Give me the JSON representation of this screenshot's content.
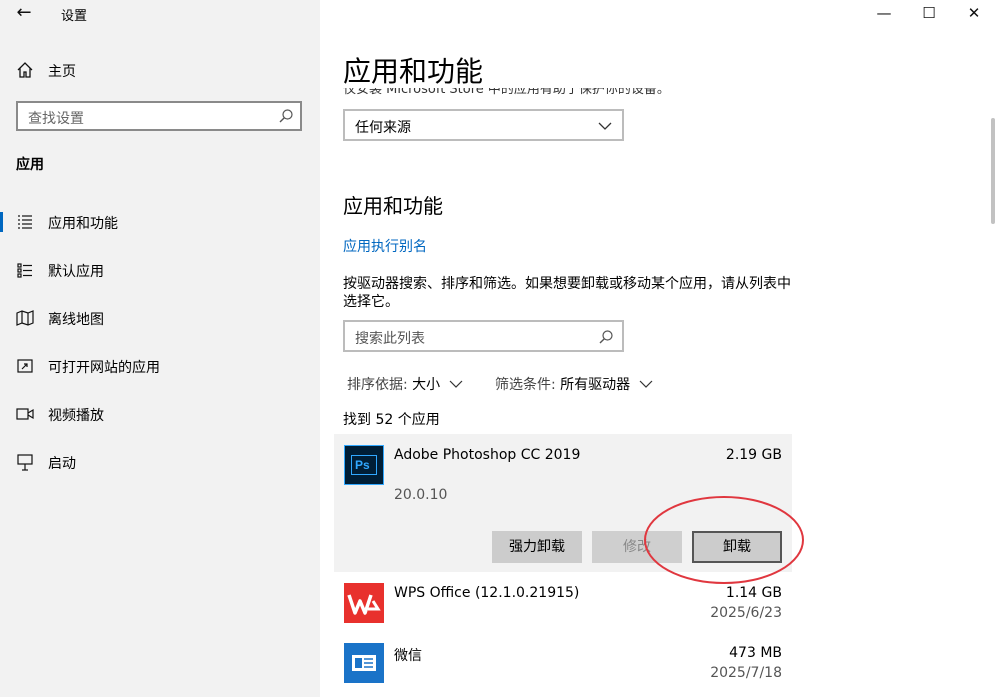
{
  "window": {
    "title": "设置",
    "controls": {
      "minimize": "—",
      "maximize": "☐",
      "close": "✕"
    }
  },
  "sidebar": {
    "home_label": "主页",
    "search_placeholder": "查找设置",
    "section_title": "应用",
    "items": [
      {
        "label": "应用和功能",
        "icon": "apps-features-icon",
        "selected": true
      },
      {
        "label": "默认应用",
        "icon": "default-apps-icon",
        "selected": false
      },
      {
        "label": "离线地图",
        "icon": "offline-maps-icon",
        "selected": false
      },
      {
        "label": "可打开网站的应用",
        "icon": "apps-for-websites-icon",
        "selected": false
      },
      {
        "label": "视频播放",
        "icon": "video-playback-icon",
        "selected": false
      },
      {
        "label": "启动",
        "icon": "startup-icon",
        "selected": false
      }
    ]
  },
  "main": {
    "page_title": "应用和功能",
    "clipped_text": "仅安装 Microsoft Store 中的应用有助于保护你的设备。",
    "source_dropdown": {
      "value": "任何来源"
    },
    "section_title": "应用和功能",
    "alias_link": "应用执行别名",
    "description": "按驱动器搜索、排序和筛选。如果想要卸载或移动某个应用，请从列表中选择它。",
    "list_search_placeholder": "搜索此列表",
    "sort": {
      "label": "排序依据:",
      "value": "大小"
    },
    "filter": {
      "label": "筛选条件:",
      "value": "所有驱动器"
    },
    "count_text": "找到 52 个应用",
    "apps": [
      {
        "name": "Adobe Photoshop CC 2019",
        "size": "2.19 GB",
        "version": "20.0.10",
        "icon_text": "Ps",
        "selected": true
      },
      {
        "name": "WPS Office (12.1.0.21915)",
        "size": "1.14 GB",
        "date": "2025/6/23"
      },
      {
        "name": "微信",
        "size": "473 MB",
        "date": "2025/7/18"
      }
    ],
    "buttons": {
      "force_uninstall": "强力卸载",
      "modify": "修改",
      "uninstall": "卸载"
    }
  },
  "colors": {
    "accent": "#0067c0",
    "sidebar_bg": "#f2f2f2",
    "highlight_ring": "#e0373f",
    "ps_blue": "#31a8ff",
    "ps_bg": "#001e36",
    "wps_red": "#e8312d"
  }
}
